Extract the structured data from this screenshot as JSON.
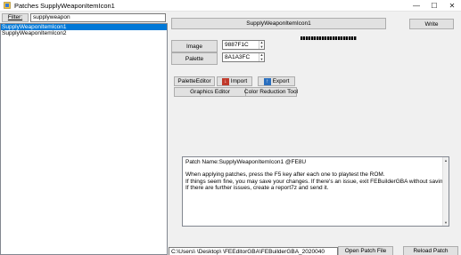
{
  "window": {
    "title": "Patches SupplyWeaponItemIcon1",
    "controls": {
      "minimize": "—",
      "maximize": "☐",
      "close": "✕"
    }
  },
  "filter": {
    "button_label": "Filter:",
    "value": "supplyweapon"
  },
  "patch_list": {
    "items": [
      {
        "label": "SupplyWeaponItemIcon1",
        "selected": true
      },
      {
        "label": "SupplyWeaponItemIcon2",
        "selected": false
      }
    ]
  },
  "detail": {
    "patch_name_button": "SupplyWeaponItemIcon1",
    "write_button": "Write",
    "image_button": "Image",
    "image_value": "9887F1C",
    "palette_button": "Palette",
    "palette_value": "8A1A3FC",
    "palette_editor_button": "PaletteEditor",
    "import_button": "Import",
    "export_button": "Export",
    "graphics_editor_button": "Graphics Editor",
    "color_reduction_button": "Color Reduction Tool",
    "info_lines": [
      "Patch Name:SupplyWeaponItemIcon1 @FE8U",
      "",
      "When applying patches, press the F5 key after each one to playtest the ROM.",
      "If things seem fine, you may save your changes. If there's an issue, exit FEBuilderGBA without saving.",
      "If there are further issues, create a report7z and send it."
    ],
    "path_value": "C:\\Users\\          \\Desktop\\          \\FEEditorGBA\\FEBuilderGBA_2020040",
    "open_patch_button": "Open Patch File",
    "reload_patch_button": "Reload Patch"
  },
  "icons": {
    "app": "app-icon",
    "import": "import-icon",
    "export": "export-icon"
  },
  "colors": {
    "selection": "#0078d7",
    "import_icon": "#c0392b",
    "export_icon": "#2a6fbf"
  }
}
